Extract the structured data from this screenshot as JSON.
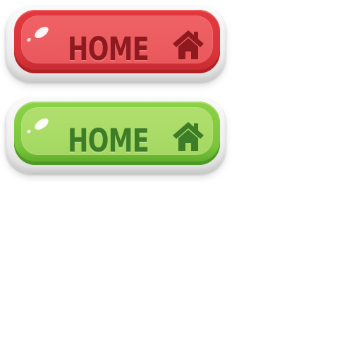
{
  "buttons": [
    {
      "label": "HOME",
      "icon": "home-icon",
      "variant": "red",
      "colors": {
        "face": "#e2383d",
        "inner": "#ef6265",
        "text": "#8e1a1f",
        "icon": "#8e1a1f"
      }
    },
    {
      "label": "HOME",
      "icon": "home-icon",
      "variant": "green",
      "colors": {
        "face": "#7cc63c",
        "inner": "#a4d862",
        "text": "#3e7d27",
        "icon": "#3e7d27"
      }
    }
  ]
}
